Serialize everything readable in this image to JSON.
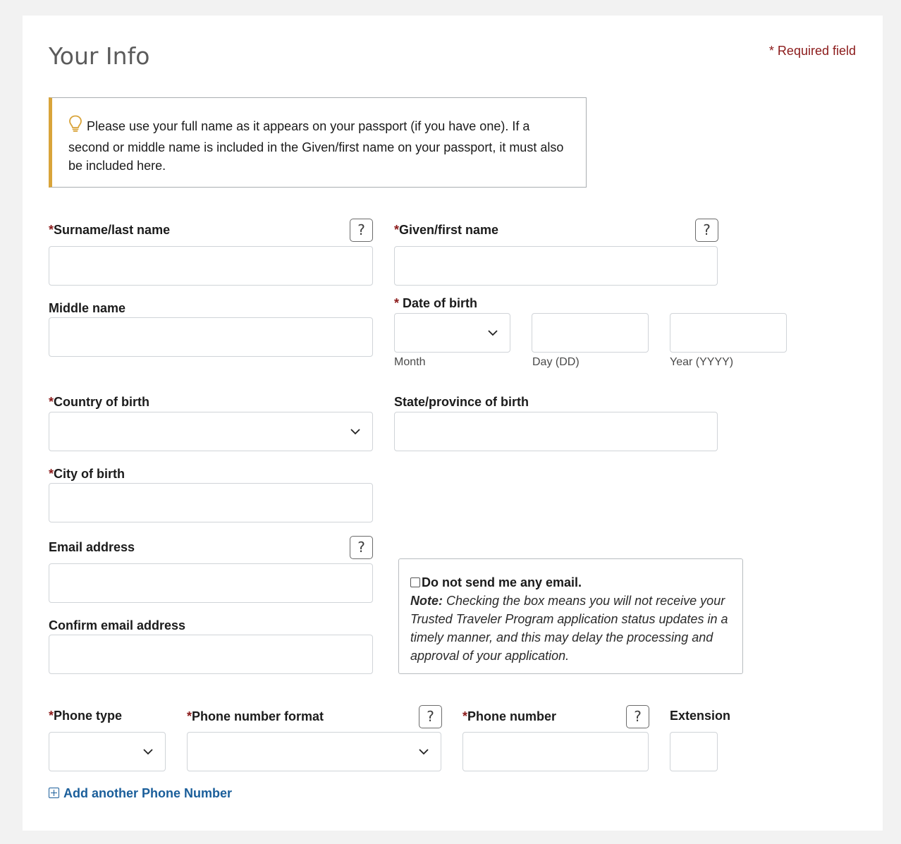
{
  "page": {
    "title": "Your Info",
    "required_note": "* Required field"
  },
  "tip": {
    "icon": "lightbulb-icon",
    "text": "Please use your full name as it appears on your passport (if you have one). If a second or middle name is included in the Given/first name on your passport, it must also be included here."
  },
  "fields": {
    "surname": {
      "required": "*",
      "label": "Surname/last name",
      "value": ""
    },
    "given_name": {
      "required": "*",
      "label": "Given/first name",
      "value": ""
    },
    "middle_name": {
      "label": "Middle name",
      "value": ""
    },
    "dob": {
      "required": "*",
      "label": " Date of birth",
      "month_label": "Month",
      "day_label": "Day (DD)",
      "year_label": "Year (YYYY)",
      "month_value": "",
      "day_value": "",
      "year_value": ""
    },
    "country_of_birth": {
      "required": "*",
      "label": "Country of birth",
      "value": ""
    },
    "state_of_birth": {
      "label": "State/province of birth",
      "value": ""
    },
    "city_of_birth": {
      "required": "*",
      "label": "City of birth",
      "value": ""
    },
    "email": {
      "label": "Email address",
      "value": ""
    },
    "confirm_email": {
      "label": "Confirm email address",
      "value": ""
    },
    "phone_type": {
      "required": "*",
      "label": "Phone type",
      "value": ""
    },
    "phone_format": {
      "required": "*",
      "label": "Phone number format",
      "value": ""
    },
    "phone_number": {
      "required": "*",
      "label": "Phone number",
      "value": ""
    },
    "extension": {
      "label": "Extension",
      "value": ""
    }
  },
  "no_email": {
    "checked": false,
    "label": "Do not send me any email.",
    "note_label": "Note:",
    "note_text": " Checking the box means you will not receive your Trusted Traveler Program application status updates in a timely manner, and this may delay the processing and approval of your application."
  },
  "help_button": {
    "label": "?"
  },
  "add_phone": {
    "label": "Add another Phone Number"
  },
  "colors": {
    "required": "#8b1a1a",
    "tip_accent": "#d9a43a",
    "link": "#1a5e9a"
  }
}
